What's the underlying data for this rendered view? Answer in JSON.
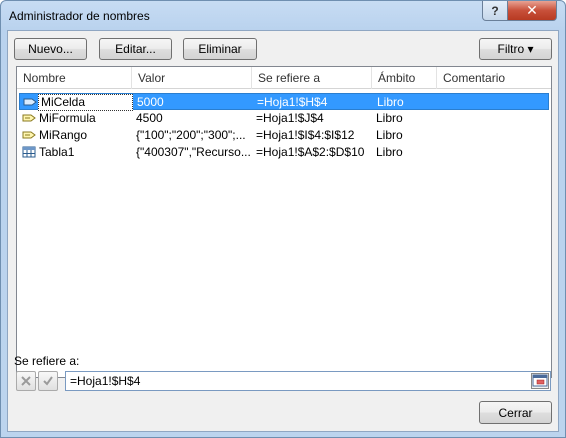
{
  "window": {
    "title": "Administrador de nombres",
    "help_label": "?",
    "close_label": "✕"
  },
  "toolbar": {
    "new_label": "Nuevo...",
    "edit_label": "Editar...",
    "delete_label": "Eliminar",
    "filter_label": "Filtro ▾"
  },
  "table": {
    "columns": [
      "Nombre",
      "Valor",
      "Se refiere a",
      "Ámbito",
      "Comentario"
    ],
    "rows": [
      {
        "name": "MiCelda",
        "value": "5000",
        "refers": "=Hoja1!$H$4",
        "scope": "Libro",
        "comment": "",
        "icon": "named-range-icon",
        "selected": true
      },
      {
        "name": "MiFormula",
        "value": "4500",
        "refers": "=Hoja1!$J$4",
        "scope": "Libro",
        "comment": "",
        "icon": "named-formula-icon",
        "selected": false
      },
      {
        "name": "MiRango",
        "value": "{\"100\";\"200\";\"300\";...",
        "refers": "=Hoja1!$I$4:$I$12",
        "scope": "Libro",
        "comment": "",
        "icon": "named-formula-icon",
        "selected": false
      },
      {
        "name": "Tabla1",
        "value": "{\"400307\",\"Recurso...",
        "refers": "=Hoja1!$A$2:$D$10",
        "scope": "Libro",
        "comment": "",
        "icon": "table-icon",
        "selected": false
      }
    ]
  },
  "refers_to": {
    "label": "Se refiere a:",
    "value": "=Hoja1!$H$4",
    "cancel_icon": "cancel-x-icon",
    "confirm_icon": "check-icon",
    "collapse_icon": "collapse-dialog-icon"
  },
  "footer": {
    "close_label": "Cerrar"
  },
  "colors": {
    "selection": "#3399ff",
    "title_bg": "#bcd4ee",
    "close_red": "#c8503a"
  }
}
